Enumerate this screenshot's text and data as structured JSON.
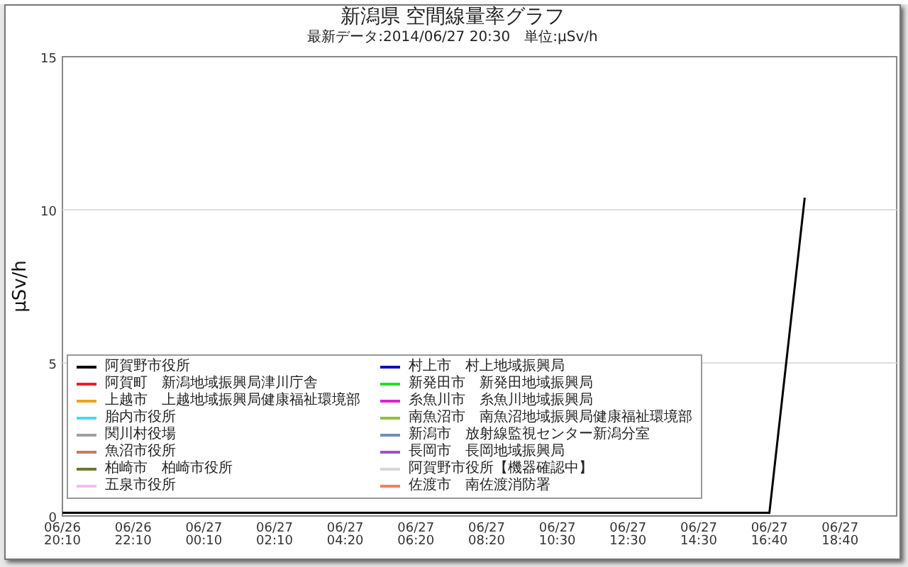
{
  "header": {
    "title": "新潟県 空間線量率グラフ",
    "subtitle": "最新データ:2014/06/27 20:30　単位:μSv/h"
  },
  "chart_data": {
    "type": "line",
    "ylabel": "μSv/h",
    "ylim": [
      0,
      15
    ],
    "yticks": [
      0,
      5,
      10,
      15
    ],
    "categories": [
      "06/26 20:10",
      null,
      "06/26 22:10",
      null,
      "06/27 00:10",
      null,
      "06/27 02:10",
      null,
      "06/27 04:20",
      null,
      "06/27 06:20",
      null,
      "06/27 08:20",
      null,
      "06/27 10:30",
      null,
      "06/27 12:30",
      null,
      "06/27 14:30",
      null,
      "06/27 16:40",
      null,
      "06/27 18:40",
      null
    ],
    "series": [
      {
        "color": "#000000",
        "values": [
          0.1,
          0.1,
          0.1,
          0.1,
          0.1,
          0.1,
          0.1,
          0.1,
          0.1,
          0.1,
          0.1,
          0.1,
          0.1,
          0.1,
          0.1,
          0.1,
          0.1,
          0.1,
          0.1,
          0.1,
          0.1,
          10.4,
          null,
          null
        ]
      }
    ]
  },
  "legend": [
    {
      "name": "阿賀野市役所",
      "color": "#000000"
    },
    {
      "name": "阿賀町　新潟地域振興局津川庁舎",
      "color": "#e8202a"
    },
    {
      "name": "上越市　上越地域振興局健康福祉環境部",
      "color": "#f0a020"
    },
    {
      "name": "胎内市役所",
      "color": "#40e0e8"
    },
    {
      "name": "関川村役場",
      "color": "#a0a0a0"
    },
    {
      "name": "魚沼市役所",
      "color": "#c87868"
    },
    {
      "name": "柏崎市　柏崎市役所",
      "color": "#6a7a30"
    },
    {
      "name": "五泉市役所",
      "color": "#f0c0f0"
    },
    {
      "name": "村上市　村上地域振興局",
      "color": "#1010c0"
    },
    {
      "name": "新発田市　新発田地域振興局",
      "color": "#20e020"
    },
    {
      "name": "糸魚川市　糸魚川地域振興局",
      "color": "#e020d0"
    },
    {
      "name": "南魚沼市　南魚沼地域振興局健康福祉環境部",
      "color": "#90c040"
    },
    {
      "name": "新潟市　放射線監視センター新潟分室",
      "color": "#7090b8"
    },
    {
      "name": "長岡市　長岡地域振興局",
      "color": "#a050d0"
    },
    {
      "name": "阿賀野市役所【機器確認中】",
      "color": "#d8d8d8"
    },
    {
      "name": "佐渡市　南佐渡消防署",
      "color": "#f08060"
    }
  ]
}
